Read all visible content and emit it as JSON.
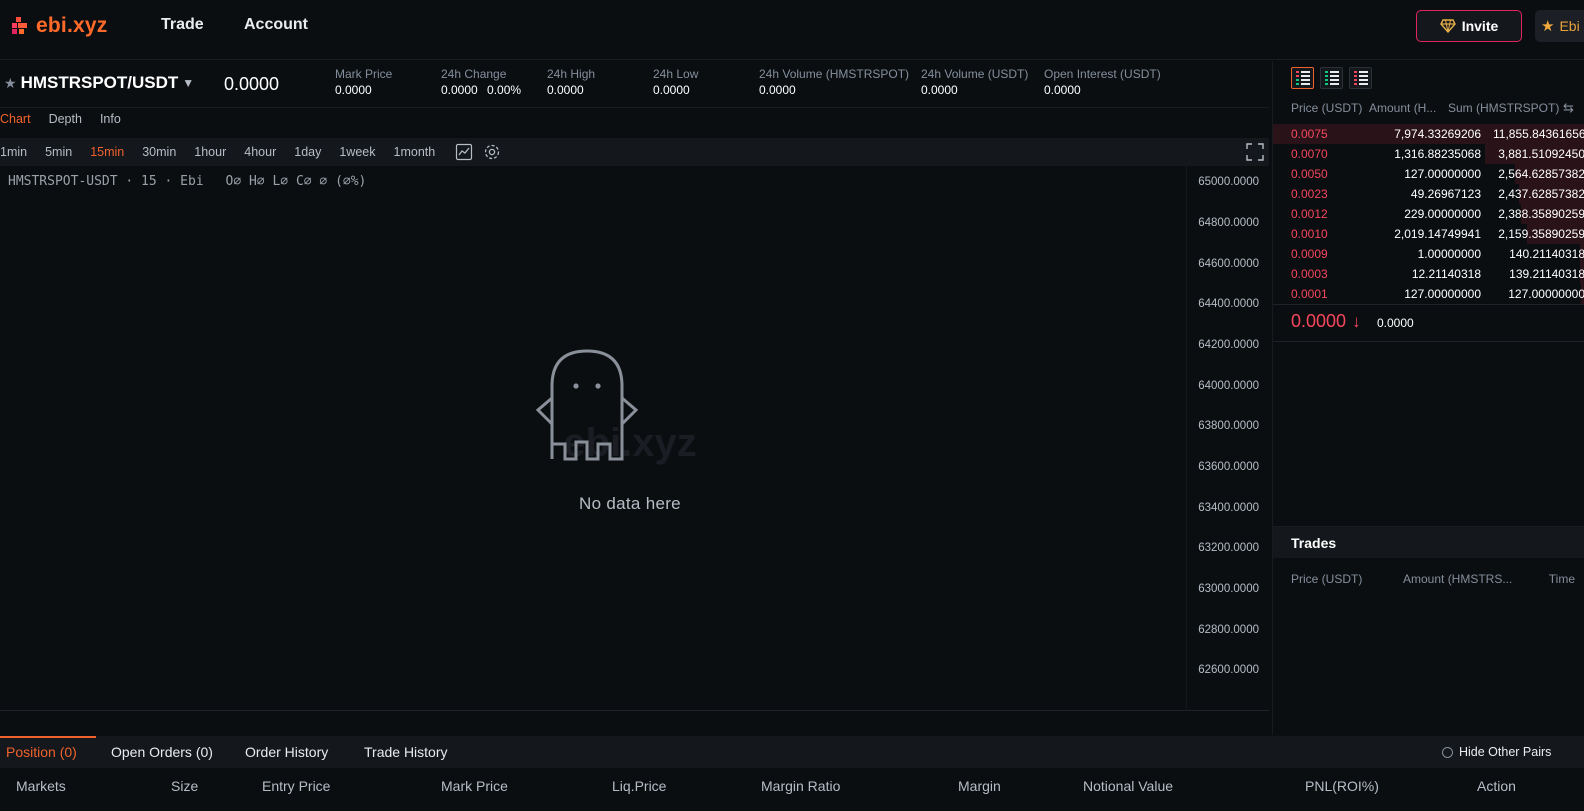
{
  "header": {
    "logo_text": "ebi.xyz",
    "nav": [
      "Trade",
      "Account"
    ],
    "invite_label": "Invite",
    "ebi_label": "Ebi"
  },
  "ticker": {
    "pair": "HMSTRSPOT/USDT",
    "last_price": "0.0000",
    "stats": [
      {
        "label": "Mark Price",
        "value": "0.0000"
      },
      {
        "label": "24h Change",
        "value": "0.0000",
        "value2": "0.00%"
      },
      {
        "label": "24h High",
        "value": "0.0000"
      },
      {
        "label": "24h Low",
        "value": "0.0000"
      },
      {
        "label": "24h Volume (HMSTRSPOT)",
        "value": "0.0000"
      },
      {
        "label": "24h Volume (USDT)",
        "value": "0.0000"
      },
      {
        "label": "Open Interest (USDT)",
        "value": "0.0000"
      }
    ]
  },
  "chart_tabs": [
    "Chart",
    "Depth",
    "Info"
  ],
  "intervals": [
    "1min",
    "5min",
    "15min",
    "30min",
    "1hour",
    "4hour",
    "1day",
    "1week",
    "1month"
  ],
  "chart": {
    "legend": "HMSTRSPOT-USDT · 15 · Ebi",
    "ohlc": "O∅ H∅ L∅ C∅ ∅ (∅%)",
    "no_data": "No data here",
    "watermark": "ebi.xyz",
    "y_ticks": [
      "65000.0000",
      "64800.0000",
      "64600.0000",
      "64400.0000",
      "64200.0000",
      "64000.0000",
      "63800.0000",
      "63600.0000",
      "63400.0000",
      "63200.0000",
      "63000.0000",
      "62800.0000",
      "62600.0000"
    ]
  },
  "orderbook": {
    "headers": [
      "Price (USDT)",
      "Amount (H...",
      "Sum (HMSTRSPOT)"
    ],
    "asks": [
      {
        "price": "0.0075",
        "amount": "7,974.33269206",
        "sum": "11,855.84361656"
      },
      {
        "price": "0.0070",
        "amount": "1,316.88235068",
        "sum": "3,881.51092450"
      },
      {
        "price": "0.0050",
        "amount": "127.00000000",
        "sum": "2,564.62857382"
      },
      {
        "price": "0.0023",
        "amount": "49.26967123",
        "sum": "2,437.62857382"
      },
      {
        "price": "0.0012",
        "amount": "229.00000000",
        "sum": "2,388.35890259"
      },
      {
        "price": "0.0010",
        "amount": "2,019.14749941",
        "sum": "2,159.35890259"
      },
      {
        "price": "0.0009",
        "amount": "1.00000000",
        "sum": "140.21140318"
      },
      {
        "price": "0.0003",
        "amount": "12.21140318",
        "sum": "139.21140318"
      },
      {
        "price": "0.0001",
        "amount": "127.00000000",
        "sum": "127.00000000"
      }
    ],
    "mid_price": "0.0000",
    "mid_sub": "0.0000"
  },
  "trades": {
    "title": "Trades",
    "headers": [
      "Price (USDT)",
      "Amount (HMSTRS...",
      "Time"
    ]
  },
  "bottom": {
    "tabs": [
      "Position (0)",
      "Open Orders (0)",
      "Order History",
      "Trade History"
    ],
    "hide_other_pairs": "Hide Other Pairs",
    "columns": [
      "Markets",
      "Size",
      "Entry Price",
      "Mark Price",
      "Liq.Price",
      "Margin Ratio",
      "Margin",
      "Notional Value",
      "PNL(ROI%)",
      "Action"
    ]
  },
  "colors": {
    "accent": "#f0622c",
    "ask": "#f6465d",
    "bg": "#0b0e11",
    "panel": "#14171c"
  }
}
